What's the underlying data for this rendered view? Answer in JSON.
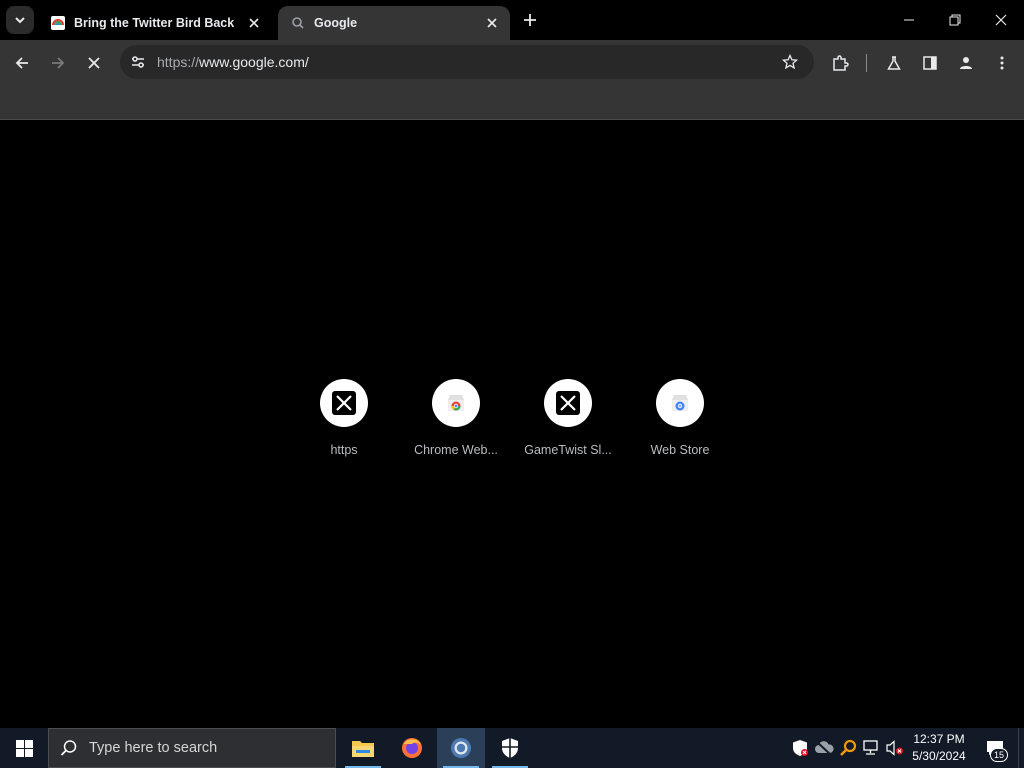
{
  "window": {
    "tabs": [
      {
        "title": "Bring the Twitter Bird Back",
        "active": false
      },
      {
        "title": "Google",
        "active": true
      }
    ]
  },
  "toolbar": {
    "url_scheme": "https://",
    "url_rest": "www.google.com/"
  },
  "shortcuts": [
    {
      "label": "https",
      "icon": "x-logo-icon"
    },
    {
      "label": "Chrome Web...",
      "icon": "chrome-web-store-icon"
    },
    {
      "label": "GameTwist Sl...",
      "icon": "x-logo-icon"
    },
    {
      "label": "Web Store",
      "icon": "web-store-icon"
    }
  ],
  "taskbar": {
    "search_placeholder": "Type here to search",
    "apps": [
      "file-explorer-icon",
      "firefox-icon",
      "chrome-icon",
      "windows-security-icon"
    ],
    "clock_time": "12:37 PM",
    "clock_date": "5/30/2024",
    "notification_count": "15"
  },
  "colors": {
    "tab_active_bg": "#353535",
    "toolbar_bg": "#353535",
    "omnibox_bg": "#282828",
    "taskbar_bg": "#111a26",
    "accent": "#76b9ed"
  }
}
